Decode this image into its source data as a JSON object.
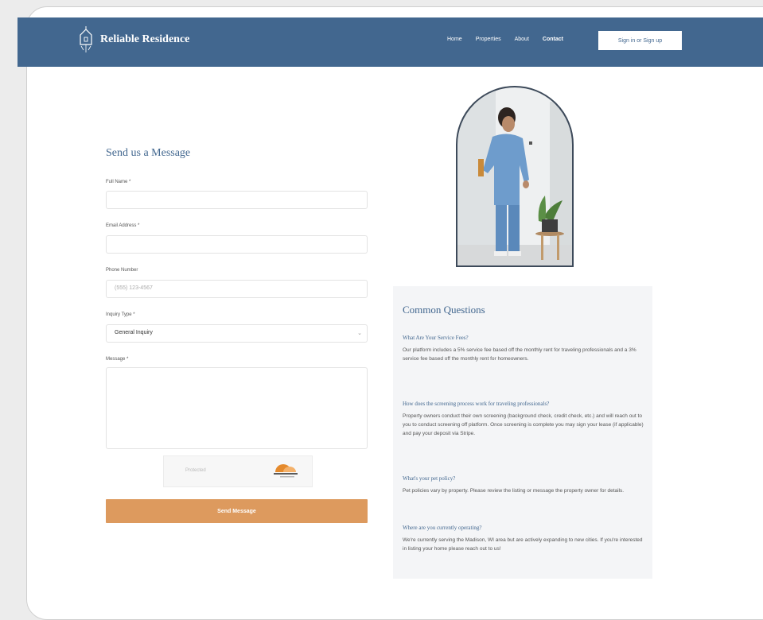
{
  "colors": {
    "primary": "#42678f",
    "accent": "#dd9a5e",
    "faq_bg": "#f4f5f7"
  },
  "nav": {
    "brand": "Reliable Residence",
    "logo_icon": "house-icon",
    "links": [
      "Home",
      "Properties",
      "About",
      "Contact"
    ],
    "signin_label": "Sign in or Sign up"
  },
  "form": {
    "title": "Send us a Message",
    "full_name_label": "Full Name *",
    "full_name_value": "",
    "email_label": "Email Address *",
    "email_value": "",
    "phone_label": "Phone Number",
    "phone_placeholder": "(555) 123-4567",
    "inquiry_label": "Inquiry Type *",
    "inquiry_value": "General Inquiry",
    "message_label": "Message *",
    "message_value": "",
    "captcha_text": "Protected",
    "submit_label": "Send Message"
  },
  "faq": {
    "title": "Common Questions",
    "items": [
      {
        "q": "What Are Your Service Fees?",
        "a": "Our platform includes a 5% service fee based off the monthly rent for traveling professionals and a 3% service fee based off the monthly rent for homeowners."
      },
      {
        "q": "How does the screening process work for traveling professionals?",
        "a": "Property owners conduct their own screening (background check, credit check, etc.) and will reach out to you to conduct screening off platform. Once screening is complete you may sign your lease (if applicable) and pay your deposit via Stripe."
      },
      {
        "q": "What's your pet policy?",
        "a": "Pet policies vary by property. Please review the listing or message the property owner for details."
      },
      {
        "q": "Where are you currently operating?",
        "a": "We're currently serving the Madison, WI area but are actively expanding to new cities. If you're interested in listing your home please reach out to us!"
      }
    ]
  }
}
